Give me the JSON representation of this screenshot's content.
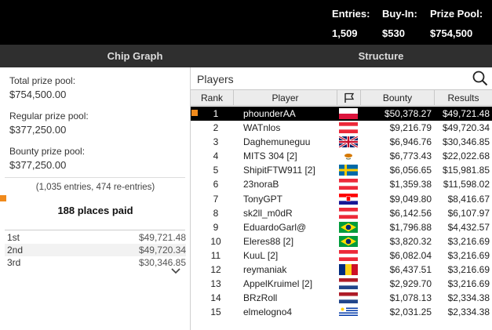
{
  "header": {
    "entries_label": "Entries:",
    "entries_value": "1,509",
    "buyin_label": "Buy-In:",
    "buyin_value": "$530",
    "prize_label": "Prize Pool:",
    "prize_value": "$754,500"
  },
  "tabs": {
    "chip_graph": "Chip Graph",
    "structure": "Structure"
  },
  "left": {
    "total_label": "Total prize pool:",
    "total_value": "$754,500.00",
    "regular_label": "Regular prize pool:",
    "regular_value": "$377,250.00",
    "bounty_label": "Bounty prize pool:",
    "bounty_value": "$377,250.00",
    "entries_note": "(1,035 entries, 474 re-entries)",
    "places_paid": "188 places paid",
    "payouts": [
      {
        "place": "1st",
        "amount": "$49,721.48"
      },
      {
        "place": "2nd",
        "amount": "$49,720.34"
      },
      {
        "place": "3rd",
        "amount": "$30,346.85"
      }
    ]
  },
  "players": {
    "title": "Players",
    "columns": {
      "rank": "Rank",
      "player": "Player",
      "bounty": "Bounty",
      "results": "Results"
    },
    "rows": [
      {
        "rank": "1",
        "player": "phounderAA",
        "flag": "PL",
        "bounty": "$50,378.27",
        "results": "$49,721.48"
      },
      {
        "rank": "2",
        "player": "WATnlos",
        "flag": "AT",
        "bounty": "$9,216.79",
        "results": "$49,720.34"
      },
      {
        "rank": "3",
        "player": "Daghemuneguu",
        "flag": "GB",
        "bounty": "$6,946.76",
        "results": "$30,346.85"
      },
      {
        "rank": "4",
        "player": "MITS 304 [2]",
        "flag": "CY",
        "bounty": "$6,773.43",
        "results": "$22,022.68"
      },
      {
        "rank": "5",
        "player": "ShipitFTW911 [2]",
        "flag": "SE",
        "bounty": "$6,056.65",
        "results": "$15,981.85"
      },
      {
        "rank": "6",
        "player": "23noraB",
        "flag": "AT",
        "bounty": "$1,359.38",
        "results": "$11,598.02"
      },
      {
        "rank": "7",
        "player": "TonyGPT",
        "flag": "HR",
        "bounty": "$9,049.80",
        "results": "$8,416.67"
      },
      {
        "rank": "8",
        "player": "sk2ll_m0dR",
        "flag": "AT",
        "bounty": "$6,142.56",
        "results": "$6,107.97"
      },
      {
        "rank": "9",
        "player": "EduardoGarl@",
        "flag": "BR",
        "bounty": "$1,796.88",
        "results": "$4,432.57"
      },
      {
        "rank": "10",
        "player": "Eleres88 [2]",
        "flag": "BR",
        "bounty": "$3,820.32",
        "results": "$3,216.69"
      },
      {
        "rank": "11",
        "player": "KuuL [2]",
        "flag": "AT",
        "bounty": "$6,082.04",
        "results": "$3,216.69"
      },
      {
        "rank": "12",
        "player": "reymaniak",
        "flag": "RO",
        "bounty": "$6,437.51",
        "results": "$3,216.69"
      },
      {
        "rank": "13",
        "player": "AppelKruimel [2]",
        "flag": "NL",
        "bounty": "$2,929.70",
        "results": "$3,216.69"
      },
      {
        "rank": "14",
        "player": "BRzRoll",
        "flag": "NL",
        "bounty": "$1,078.13",
        "results": "$2,334.38"
      },
      {
        "rank": "15",
        "player": "elmelogno4",
        "flag": "UY",
        "bounty": "$2,031.25",
        "results": "$2,334.38"
      }
    ],
    "markers": [
      "1",
      "7"
    ]
  },
  "colors": {
    "header_bg": "#000000",
    "tabbar_bg": "#2f2f2f",
    "marker": "#f08a1c",
    "selected_row_bg": "#000000"
  },
  "icons": {
    "search": "search-icon",
    "flag_column": "flag-icon",
    "expand": "chevron-down-icon"
  }
}
